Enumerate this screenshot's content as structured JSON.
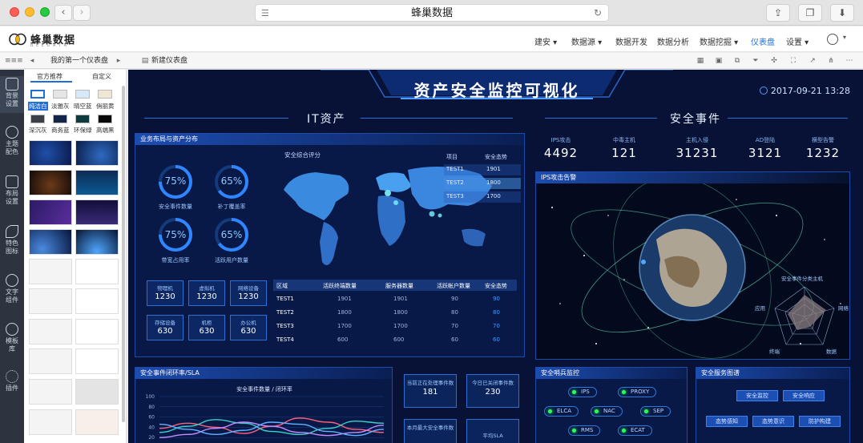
{
  "browser": {
    "url_title": "蜂巢数据"
  },
  "app": {
    "logo": "蜂巢数据",
    "logo_sub": "B E E D A T A",
    "menu": [
      "建安 ▾",
      "数据源 ▾",
      "数据开发",
      "数据分析",
      "数据挖掘 ▾",
      "仪表盘",
      "设置 ▾"
    ],
    "active_menu": "仪表盘"
  },
  "tabs": {
    "first": "我的第一个仪表盘",
    "new": "新建仪表盘"
  },
  "rail": [
    "背景设置",
    "主题配色",
    "布局设置",
    "特色图标",
    "文字组件",
    "模板库",
    "插件"
  ],
  "panel": {
    "tabs": [
      "官方推荐",
      "自定义"
    ],
    "themes": [
      {
        "label": "纯洁白",
        "color": "#ffffff",
        "selected": true
      },
      {
        "label": "淡雅灰",
        "color": "#e5e5e5"
      },
      {
        "label": "晴空蓝",
        "color": "#d7e8fb"
      },
      {
        "label": "俏丽黄",
        "color": "#efe6d6"
      },
      {
        "label": "深沉灰",
        "color": "#3a3f4a"
      },
      {
        "label": "商务蓝",
        "color": "#14254a"
      },
      {
        "label": "环保绿",
        "color": "#0f3b3f"
      },
      {
        "label": "高端黑",
        "color": "#0a0a0a"
      }
    ]
  },
  "dashboard": {
    "title": "资产安全监控可视化",
    "datetime": "2017-09-21  13:28",
    "section_it": "IT资产",
    "section_sec": "安全事件",
    "asset_panel_title": "业务布局与资产分布",
    "rings": [
      {
        "value": "75%",
        "label": "安全事件数量"
      },
      {
        "value": "65%",
        "label": "补丁覆盖率"
      },
      {
        "value": "75%",
        "label": "带宽占用率"
      },
      {
        "value": "65%",
        "label": "活跃用户数量"
      }
    ],
    "stats": [
      {
        "label": "物理机",
        "value": "1230"
      },
      {
        "label": "虚拟机",
        "value": "1230"
      },
      {
        "label": "网络设备",
        "value": "1230"
      },
      {
        "label": "存储设备",
        "value": "630"
      },
      {
        "label": "机柜",
        "value": "630"
      },
      {
        "label": "办公机",
        "value": "630"
      }
    ],
    "map_title": "安全综合评分",
    "mini_table": {
      "headers": [
        "项目",
        "安全态势"
      ],
      "rows": [
        [
          "TEST1",
          "1901"
        ],
        [
          "TEST2",
          "1800"
        ],
        [
          "TEST3",
          "1700"
        ]
      ]
    },
    "asset_table": {
      "headers": [
        "区域",
        "活跃终端数量",
        "服务器数量",
        "活跃帐户数量",
        "安全态势"
      ],
      "rows": [
        [
          "TEST1",
          "1901",
          "1901",
          "90",
          "90"
        ],
        [
          "TEST2",
          "1800",
          "1800",
          "80",
          "80"
        ],
        [
          "TEST3",
          "1700",
          "1700",
          "70",
          "70"
        ],
        [
          "TEST4",
          "600",
          "600",
          "60",
          "60"
        ]
      ]
    },
    "kpis": [
      {
        "label": "IPS攻击",
        "value": "4492"
      },
      {
        "label": "中毒主机",
        "value": "121"
      },
      {
        "label": "主机入侵",
        "value": "31231"
      },
      {
        "label": "AD登陆",
        "value": "3121"
      },
      {
        "label": "横型告警",
        "value": "1232"
      }
    ],
    "ips_title": "IPS攻击告警",
    "radar": {
      "title": "安全事件分类主机",
      "axes": [
        "应用",
        "网络",
        "终端",
        "数据"
      ]
    },
    "closure_title": "安全事件闭环率/SLA",
    "metric_boxes": [
      {
        "label": "当前正在处理事件数",
        "value": "181"
      },
      {
        "label": "今日已关闭事件数",
        "value": "230"
      },
      {
        "label": "本月最大安全事件数",
        "value": ""
      },
      {
        "label": "平均SLA",
        "value": ""
      }
    ],
    "sentinel_title": "安全哨兵监控",
    "sentinels": [
      "IPS",
      "PROXY",
      "ELCA",
      "NAC",
      "SEP",
      "RMS",
      "ECAT"
    ],
    "service_title": "安全服务图谱",
    "services": [
      "安全监控",
      "安全响应",
      "态势感知",
      "态势意识",
      "防护构建"
    ]
  },
  "chart_data": {
    "type": "line",
    "title": "安全事件数量 / 闭环率",
    "xlabel": "",
    "ylabel": "",
    "ylim": [
      0,
      100
    ],
    "yticks": [
      100,
      80,
      60,
      40,
      20
    ],
    "x": [
      0,
      1,
      2,
      3,
      4,
      5,
      6,
      7,
      8
    ],
    "series": [
      {
        "color": "#ff5f7a",
        "values": [
          38,
          48,
          40,
          28,
          42,
          58,
          50,
          36,
          30
        ]
      },
      {
        "color": "#3ad1c9",
        "values": [
          30,
          42,
          55,
          48,
          32,
          26,
          38,
          52,
          48
        ]
      },
      {
        "color": "#c38cff",
        "values": [
          20,
          26,
          38,
          50,
          42,
          30,
          24,
          30,
          44
        ]
      },
      {
        "color": "#5fb2ff",
        "values": [
          46,
          36,
          26,
          34,
          50,
          46,
          32,
          24,
          36
        ]
      }
    ]
  }
}
